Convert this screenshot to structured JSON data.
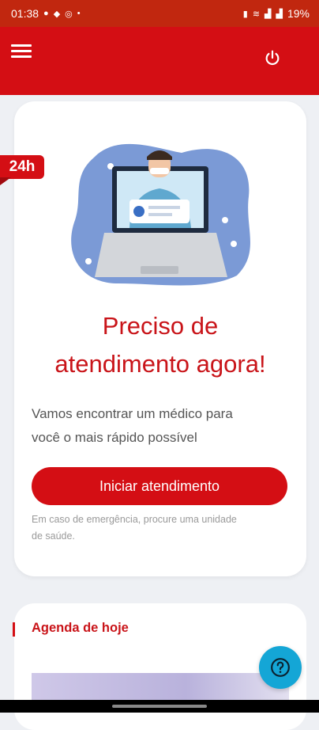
{
  "status_bar": {
    "time": "01:38",
    "battery": "19%",
    "left_icons": [
      "notification-dot-icon",
      "app-icon",
      "chat-icon",
      "dot-icon"
    ],
    "right_icons": [
      "battery-saver-icon",
      "wifi-icon",
      "signal-icon",
      "signal-icon"
    ]
  },
  "app_bar": {
    "background": "#d40e14",
    "icons": [
      "menu-icon",
      "power-icon"
    ]
  },
  "main_card": {
    "badge": "24h",
    "title_line1": "Preciso de",
    "title_line2": "atendimento agora!",
    "subtitle_line1": "Vamos encontrar um médico para",
    "subtitle_line2": "você o mais rápido possível",
    "cta_label": "Iniciar atendimento",
    "note_line1": "Em caso de emergência, procure uma unidade",
    "note_line2": "de saúde."
  },
  "agenda_card": {
    "title": "Agenda de hoje"
  },
  "help_button": {
    "icon": "question-icon",
    "color": "#14a6d6"
  },
  "colors": {
    "brand_red": "#d40e14",
    "status_red": "#c1270f",
    "help_blue": "#14a6d6"
  }
}
